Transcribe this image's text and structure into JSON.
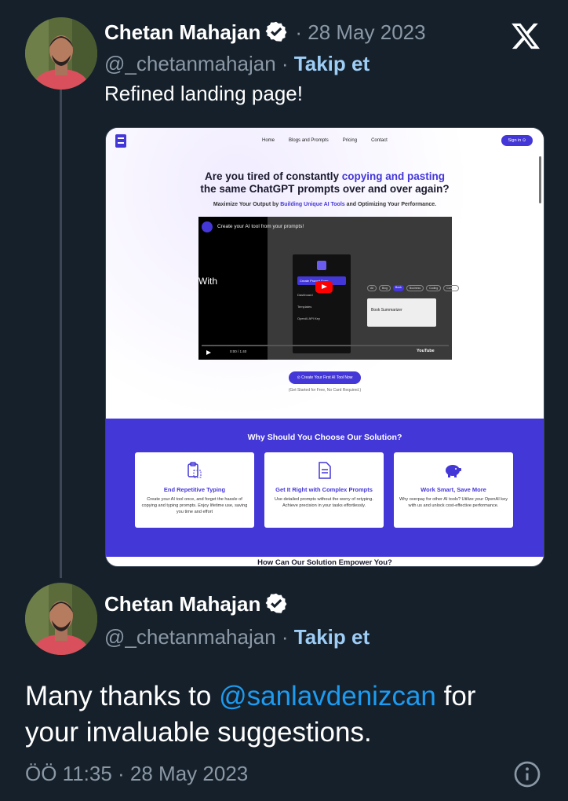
{
  "tweet1": {
    "name": "Chetan Mahajan",
    "date": "· 28 May 2023",
    "handle": "@_chetanmahajan",
    "sep": "·",
    "follow": "Takip et",
    "text": "Refined landing page!"
  },
  "x_logo": "x-logo-icon",
  "screenshot": {
    "nav": [
      "Home",
      "Blogs and Prompts",
      "Pricing",
      "Contact"
    ],
    "signin": "Sign in ⊙",
    "headline_a": "Are you tired of constantly ",
    "headline_hl": "copying and pasting",
    "headline_b": "the same ChatGPT prompts over and over again?",
    "sub_a": "Maximize Your Output by ",
    "sub_hl": "Building Unique AI Tools",
    "sub_b": " and Optimizing Your Performance.",
    "video_title": "Create your AI tool from your prompts!",
    "video_side": "With",
    "menu": [
      "Create Prompt Form",
      "Dashboard",
      "Templates",
      "OpenAI API Key"
    ],
    "tags": [
      "All",
      "Blog",
      "Book",
      "Business",
      "Coding",
      "Content"
    ],
    "book": "Book Summarizer",
    "time": "0:00 / 1:40",
    "yt": "YouTube",
    "cta": "⊙ Create Your First AI Tool Now",
    "cta_note": "(Get Started for Free, No Card Required.)",
    "why": "Why Should You Choose Our Solution?",
    "features": [
      {
        "title": "End Repetitive Typing",
        "desc": "Create your AI tool once, and forget the hassle of copying and typing prompts. Enjoy lifetime use, saving you time and effort"
      },
      {
        "title": "Get It Right with Complex Prompts",
        "desc": "Use detailed prompts without the worry of retyping. Achieve precision in your tasks effortlessly."
      },
      {
        "title": "Work Smart, Save More",
        "desc": "Why overpay for other AI tools? Utilize your OpenAI key with us and unlock cost-effective performance."
      }
    ],
    "how": "How Can Our Solution Empower You?"
  },
  "tweet2": {
    "name": "Chetan Mahajan",
    "handle": "@_chetanmahajan",
    "sep": "·",
    "follow": "Takip et",
    "text_a": "Many thanks to ",
    "mention": "@sanlavdenizcan",
    "text_b": " for",
    "text_c": "your invaluable suggestions.",
    "timestamp": "ÖÖ 11:35 · 28 May 2023"
  },
  "colors": {
    "accent": "#1d9bf0",
    "follow": "#9ecdf5",
    "brand": "#4437d8",
    "bg": "#15202b"
  }
}
